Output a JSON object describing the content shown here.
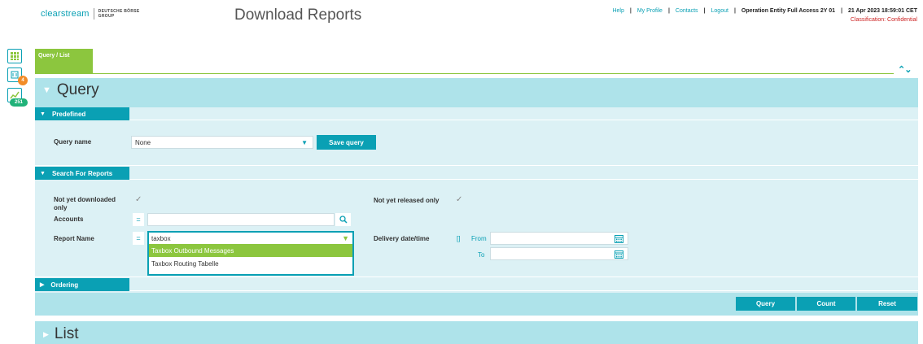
{
  "header": {
    "brand": "clearstream",
    "brand_group_line1": "DEUTSCHE BÖRSE",
    "brand_group_line2": "GROUP",
    "title": "Download Reports",
    "nav": [
      "Help",
      "My Profile",
      "Contacts",
      "Logout"
    ],
    "account": "Operation Entity Full Access 2Y 01",
    "datetime": "21 Apr 2023 18:59:01 CET",
    "classification": "Classification: Confidential"
  },
  "sidebar": {
    "icons": [
      "grid-icon",
      "notifications-icon",
      "chart-icon"
    ],
    "badge_notifications": "4",
    "badge_chart": "251"
  },
  "tab": {
    "label": "Query / List"
  },
  "query_panel": {
    "title": "Query",
    "predefined": {
      "header": "Predefined",
      "query_name_label": "Query name",
      "query_name_value": "None",
      "save_button": "Save query"
    },
    "search": {
      "header": "Search For Reports",
      "not_downloaded_label": "Not yet downloaded only",
      "not_released_label": "Not yet released only",
      "accounts_label": "Accounts",
      "accounts_operator": "=",
      "report_name_label": "Report Name",
      "report_name_operator": "=",
      "report_name_value": "taxbox",
      "report_name_options": [
        "Taxbox Outbound Messages",
        "Taxbox Routing Tabelle"
      ],
      "delivery_label": "Delivery date/time",
      "delivery_operator": "[]",
      "from_label": "From",
      "to_label": "To"
    },
    "ordering": {
      "header": "Ordering"
    },
    "buttons": {
      "query": "Query",
      "count": "Count",
      "reset": "Reset"
    }
  },
  "list_panel": {
    "title": "List"
  },
  "colors": {
    "accent": "#0aa0b4",
    "green": "#8cc63e",
    "panel": "#aee3ea",
    "inner": "#dcf1f5"
  }
}
